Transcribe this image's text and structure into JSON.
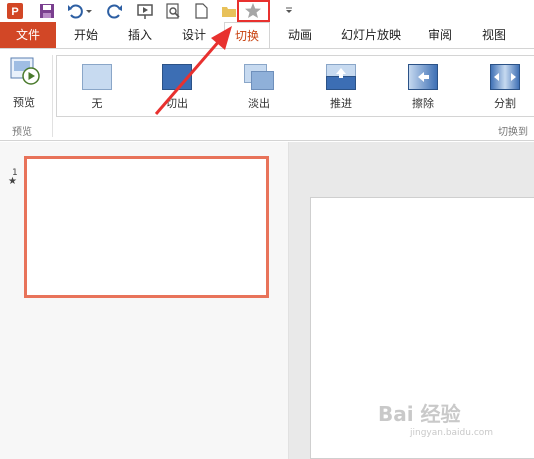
{
  "tabs": {
    "file": "文件",
    "home": "开始",
    "insert": "插入",
    "design": "设计",
    "transitions": "切换",
    "animations": "动画",
    "slideshow": "幻灯片放映",
    "review": "审阅",
    "view": "视图"
  },
  "ribbon": {
    "preview_label": "预览",
    "preview_group": "预览",
    "transitions_group": "切换到",
    "transitions": [
      {
        "label": "无"
      },
      {
        "label": "切出"
      },
      {
        "label": "淡出"
      },
      {
        "label": "推进"
      },
      {
        "label": "擦除"
      },
      {
        "label": "分割"
      }
    ]
  },
  "slide_panel": {
    "slide_number": "1",
    "slide_star": "★"
  },
  "watermark": {
    "text": "Bai 经验",
    "sub": "jingyan.baidu.com"
  },
  "colors": {
    "accent": "#d24726",
    "highlight": "#e8312f",
    "thumb_border": "#e8735a"
  }
}
